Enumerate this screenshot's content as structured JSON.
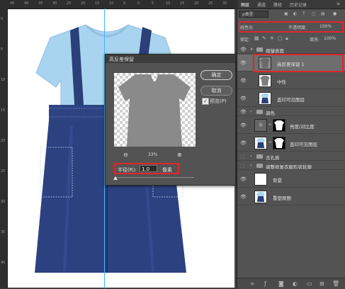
{
  "ruler": {
    "top_marks": [
      "45",
      "40",
      "35",
      "30",
      "25",
      "20",
      "15",
      "10",
      "5",
      "0",
      "5",
      "10",
      "15",
      "20",
      "25",
      "30"
    ],
    "left_marks": [
      "0",
      "5",
      "10",
      "15",
      "20",
      "25",
      "30",
      "35",
      "40"
    ]
  },
  "dialog": {
    "title": "高反差保留",
    "ok_label": "确定",
    "cancel_label": "取消",
    "preview_label": "预览(P)",
    "preview_checked": "✓",
    "zoom_out_label": "⊖",
    "zoom_value": "33%",
    "zoom_in_label": "⊕",
    "radius_label": "半径(R):",
    "radius_value": "1.0",
    "radius_unit": "像素",
    "radius_slider_level": 0.02
  },
  "panel": {
    "tabs": [
      "图层",
      "通道",
      "路径",
      "历史记录"
    ],
    "filter_kind": "ρ类型",
    "blend_mode": "线性光",
    "opacity_label": "不透明度:",
    "opacity_value": "100%",
    "lock_label": "锁定:",
    "fill_label": "填充:",
    "fill_value": "100%",
    "layers": [
      {
        "name": "褶皱表面",
        "type": "group"
      },
      {
        "name": "高反差保留 1",
        "type": "layer"
      },
      {
        "name": "中性",
        "type": "layer"
      },
      {
        "name": "盖印可见图层",
        "type": "layer"
      },
      {
        "name": "调色",
        "type": "group"
      },
      {
        "name": "亮度/对比度",
        "type": "adjust"
      },
      {
        "name": "盖印可见图层",
        "type": "layer"
      },
      {
        "name": "去孔质",
        "type": "group"
      },
      {
        "name": "调整修复衣服形状轮廓",
        "type": "group"
      },
      {
        "name": "背景",
        "type": "layer"
      },
      {
        "name": "重塑原图",
        "type": "layer"
      }
    ]
  },
  "colors": {
    "accent_red": "#e0262b",
    "guide_blue": "#3fb6ff",
    "shirt_blue": "#a9d4ef",
    "overalls_navy": "#2b3f78"
  }
}
